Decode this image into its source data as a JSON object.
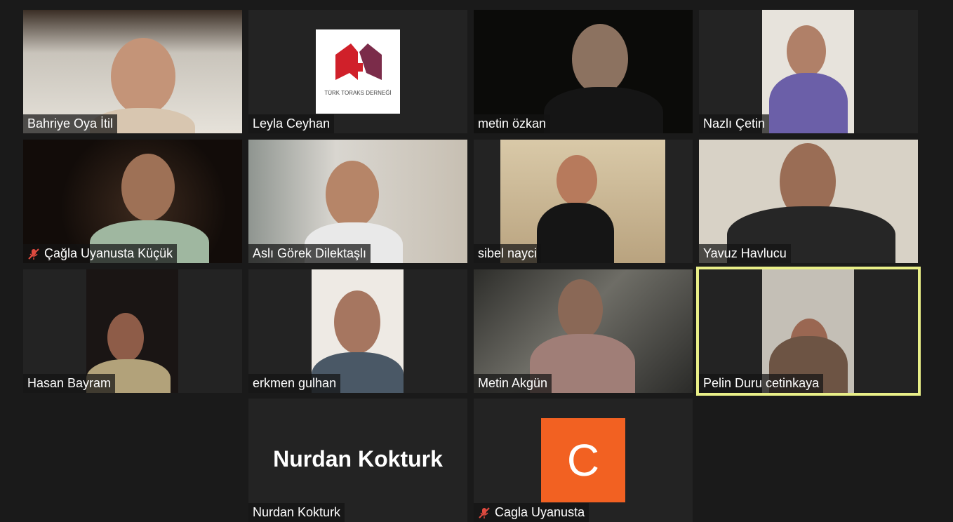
{
  "participants": [
    {
      "name": "Bahriye Oya İtil",
      "muted": false
    },
    {
      "name": "Leyla Ceyhan",
      "muted": false,
      "logo_text": "TÜRK TORAKS DERNEĞİ"
    },
    {
      "name": "metin özkan",
      "muted": false
    },
    {
      "name": "Nazlı Çetin",
      "muted": false
    },
    {
      "name": "Çağla Uyanusta Küçük",
      "muted": true
    },
    {
      "name": "Aslı Görek Dilektaşlı",
      "muted": false
    },
    {
      "name": "sibel nayci",
      "muted": false
    },
    {
      "name": "Yavuz Havlucu",
      "muted": false
    },
    {
      "name": "Hasan Bayram",
      "muted": false
    },
    {
      "name": "erkmen gulhan",
      "muted": false
    },
    {
      "name": "Metin Akgün",
      "muted": false
    },
    {
      "name": "Pelin Duru cetinkaya",
      "muted": false,
      "active_speaker": true
    },
    {
      "name": "Nurdan Kokturk",
      "muted": false,
      "display_name_large": "Nurdan Kokturk"
    },
    {
      "name": "Cagla Uyanusta",
      "muted": true,
      "avatar_letter": "C",
      "avatar_color": "#f26122"
    }
  ],
  "colors": {
    "active_border": "#e9ef88",
    "background": "#1a1a1a",
    "muted_icon": "#e04a3f"
  }
}
